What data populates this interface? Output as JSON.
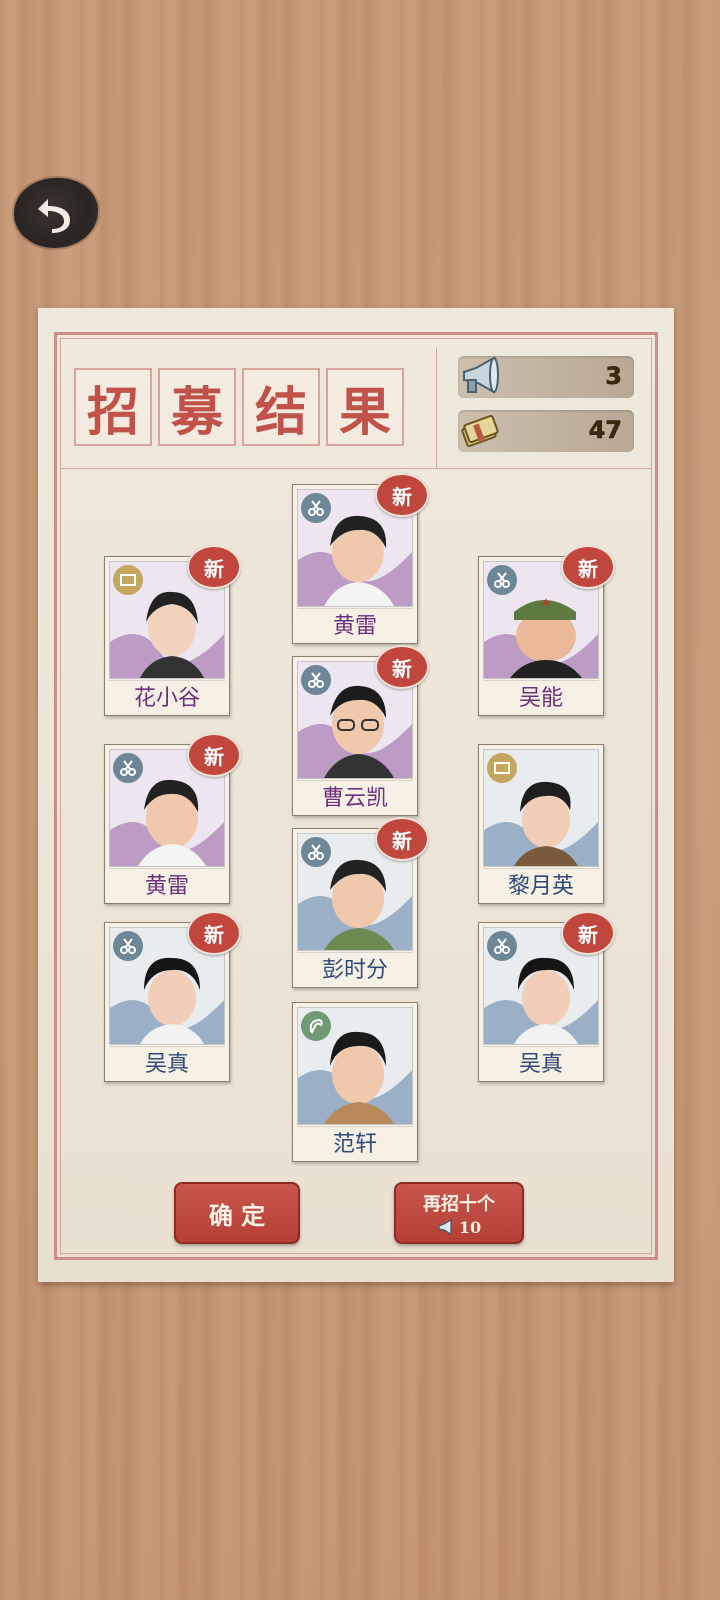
{
  "header": {
    "title_chars": [
      "招",
      "募",
      "结",
      "果"
    ],
    "resources": [
      {
        "icon": "megaphone-icon",
        "value": "3"
      },
      {
        "icon": "cash-icon",
        "value": "47"
      }
    ]
  },
  "badge_text": "新",
  "cards": [
    {
      "name": "花小谷",
      "role_icon": "tie-icon",
      "tier": "purple",
      "is_new": true
    },
    {
      "name": "黄雷",
      "role_icon": "scissors-icon",
      "tier": "purple",
      "is_new": true
    },
    {
      "name": "吴能",
      "role_icon": "scissors-icon",
      "tier": "purple",
      "is_new": true
    },
    {
      "name": "曹云凯",
      "role_icon": "scissors-icon",
      "tier": "purple",
      "is_new": true
    },
    {
      "name": "黄雷",
      "role_icon": "scissors-icon",
      "tier": "purple",
      "is_new": true
    },
    {
      "name": "黎月英",
      "role_icon": "tie-icon",
      "tier": "blue",
      "is_new": false
    },
    {
      "name": "彭时分",
      "role_icon": "scissors-icon",
      "tier": "blue",
      "is_new": true
    },
    {
      "name": "吴真",
      "role_icon": "scissors-icon",
      "tier": "blue",
      "is_new": true
    },
    {
      "name": "吴真",
      "role_icon": "scissors-icon",
      "tier": "blue",
      "is_new": true
    },
    {
      "name": "范轩",
      "role_icon": "sickle-icon",
      "tier": "blue",
      "is_new": false
    }
  ],
  "buttons": {
    "confirm_label": "确 定",
    "recruit_again_label": "再招十个",
    "recruit_again_cost": "10"
  },
  "colors": {
    "accent_red": "#c0524a",
    "purple_tier": "#6e2f7d",
    "blue_tier": "#2e4a7a"
  }
}
